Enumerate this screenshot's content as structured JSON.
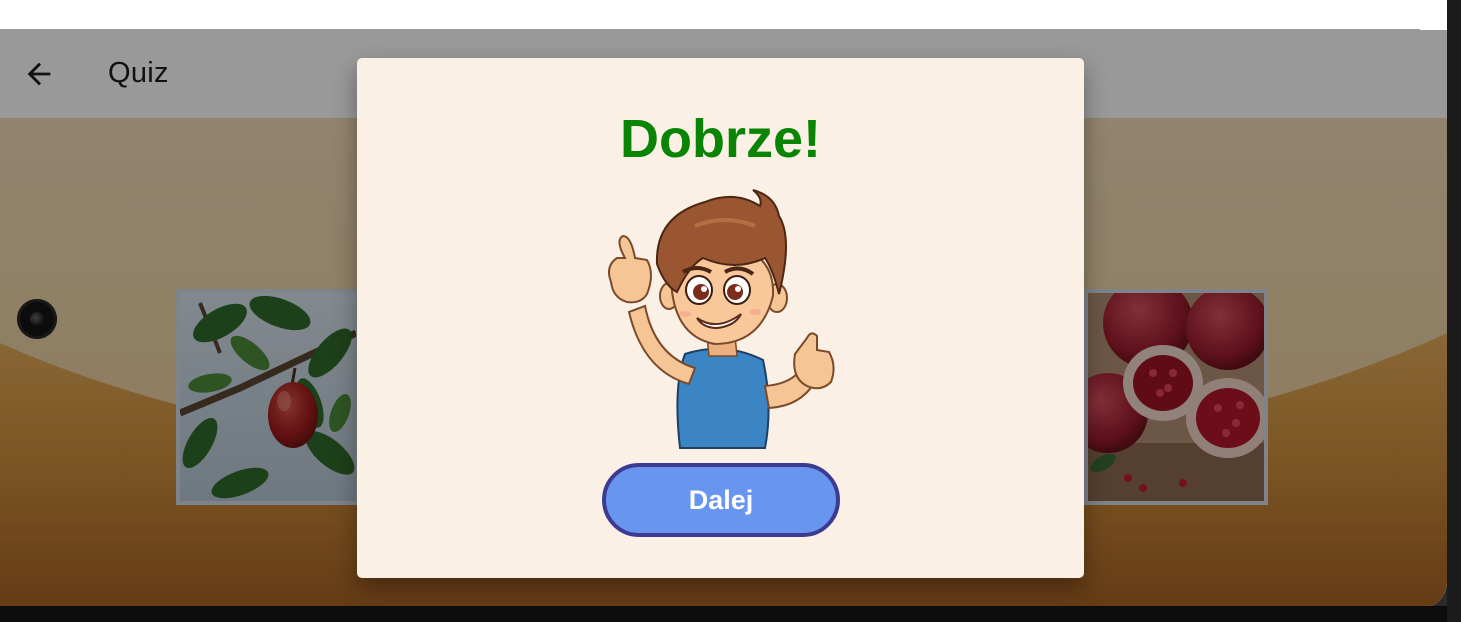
{
  "app": {
    "title": "Quiz"
  },
  "appbar": {
    "back_icon": "arrow-left-icon"
  },
  "background": {
    "top_color": "#f0d2a6",
    "wave_color": "#d79d4a",
    "bottom_color": "#b06f2a"
  },
  "quiz": {
    "images": [
      {
        "subject": "apple",
        "position": "left"
      },
      {
        "subject": "pomegranate",
        "position": "right"
      }
    ]
  },
  "dialog": {
    "title": "Dobrze!",
    "title_color": "#0a8405",
    "illustration": "thumbs-up-boy",
    "button_label": "Dalej",
    "button_color": "#6895ee",
    "button_border_color": "#3c3b92"
  }
}
